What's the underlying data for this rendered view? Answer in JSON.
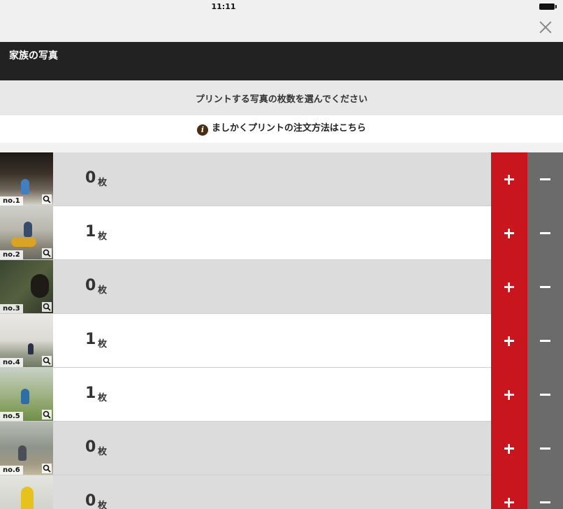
{
  "status_bar": {
    "time": "11:11"
  },
  "header": {
    "title": "家族の写真",
    "close_icon": "close-icon"
  },
  "instruction": "プリントする写真の枚数を選んでください",
  "info_link": {
    "icon": "info-icon",
    "label": "ましかくプリントの注文方法はこちら"
  },
  "colors": {
    "plus": "#c9161e",
    "minus": "#6b6b6b",
    "title_bar": "#222222",
    "selected_row": "#ffffff",
    "unselected_row": "#dcdcdc"
  },
  "photos": [
    {
      "no": "no.1",
      "count": "0",
      "unit": "枚"
    },
    {
      "no": "no.2",
      "count": "1",
      "unit": "枚"
    },
    {
      "no": "no.3",
      "count": "0",
      "unit": "枚"
    },
    {
      "no": "no.4",
      "count": "1",
      "unit": "枚"
    },
    {
      "no": "no.5",
      "count": "1",
      "unit": "枚"
    },
    {
      "no": "no.6",
      "count": "0",
      "unit": "枚"
    },
    {
      "no": "",
      "count": "0",
      "unit": "枚"
    }
  ]
}
